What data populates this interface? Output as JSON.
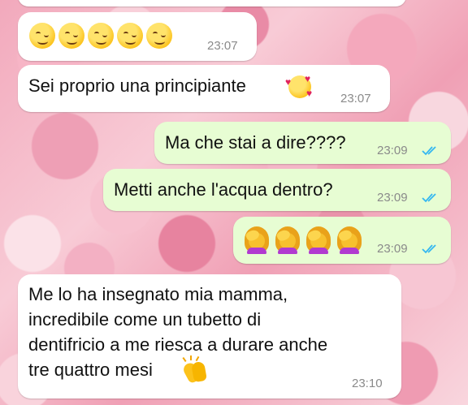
{
  "chat": {
    "messages": [
      {
        "direction": "incoming",
        "text": "",
        "emoji": [
          "winking-face",
          "winking-face",
          "winking-face",
          "winking-face",
          "winking-face"
        ],
        "time": "23:07"
      },
      {
        "direction": "incoming",
        "text": "Sei proprio una principiante",
        "emoji": [
          "smiling-face-with-hearts"
        ],
        "time": "23:07"
      },
      {
        "direction": "outgoing",
        "text": "Ma che stai a dire????",
        "time": "23:09",
        "status": "read"
      },
      {
        "direction": "outgoing",
        "text": "Metti anche l'acqua dentro?",
        "time": "23:09",
        "status": "read"
      },
      {
        "direction": "outgoing",
        "text": "",
        "emoji": [
          "woman-facepalming",
          "woman-facepalming",
          "woman-facepalming",
          "woman-facepalming"
        ],
        "time": "23:09",
        "status": "read"
      },
      {
        "direction": "incoming",
        "lines": [
          "Me lo ha insegnato mia mamma,",
          "incredibile come un tubetto di",
          "dentifricio a me riesca a durare anche",
          "tre quattro mesi"
        ],
        "emoji": [
          "clapping-hands"
        ],
        "time": "23:10"
      }
    ]
  },
  "colors": {
    "incoming_bubble": "#ffffff",
    "outgoing_bubble": "#e7fdd3",
    "read_ticks": "#34b7f1",
    "timestamp": "#8a8a8a"
  }
}
